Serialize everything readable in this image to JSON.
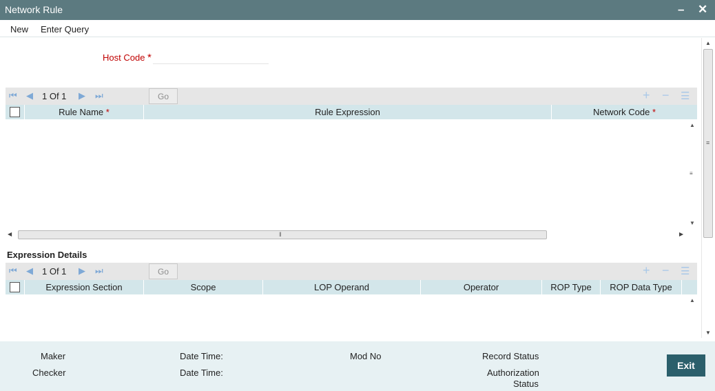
{
  "window": {
    "title": "Network Rule",
    "minimize_glyph": "–",
    "close_glyph": "✕"
  },
  "menu": {
    "items": [
      "New",
      "Enter Query"
    ]
  },
  "form": {
    "host_code_label": "Host Code",
    "required_mark": "*",
    "host_code_value": ""
  },
  "rule_grid": {
    "pager": "1 Of 1",
    "go_label": "Go",
    "columns": [
      "Rule Name",
      "Rule Expression",
      "Network Code"
    ],
    "required_mark": "*",
    "rows": []
  },
  "expression_details": {
    "title": "Expression Details",
    "pager": "1 Of 1",
    "go_label": "Go",
    "columns": [
      "Expression Section",
      "Scope",
      "LOP Operand",
      "Operator",
      "ROP Type",
      "ROP Data Type"
    ],
    "rows": []
  },
  "icons": {
    "first": "first-page-icon",
    "prev": "prev-page-icon",
    "next": "next-page-icon",
    "last": "last-page-icon",
    "add": "plus-icon",
    "remove": "minus-icon",
    "view": "list-icon"
  },
  "footer": {
    "maker": "Maker",
    "checker": "Checker",
    "date_time": "Date Time:",
    "mod_no": "Mod No",
    "record_status": "Record Status",
    "authorization": "Authorization",
    "status": "Status",
    "exit_label": "Exit"
  },
  "colors": {
    "titlebar": "#5c7a80",
    "grid_header": "#d3e6ea",
    "toolbar": "#e6e6e6",
    "footer": "#e7f1f3",
    "exit_button": "#2b5f6b",
    "required": "#c00000"
  }
}
